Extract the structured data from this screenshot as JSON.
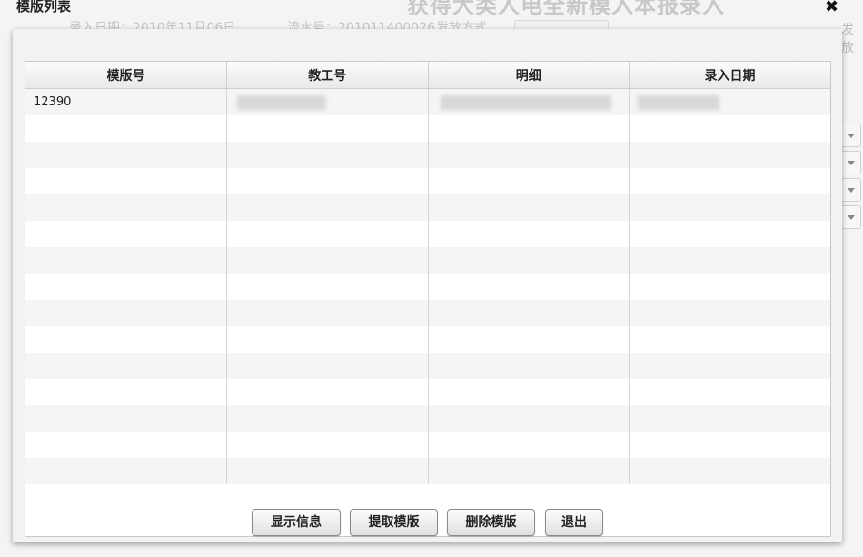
{
  "background": {
    "title": "获得大类人电全新模入本报录入",
    "meta_items": [
      "录入日期：2010年11月06日",
      "流水号：201011400026",
      "发放方式"
    ],
    "right_text": "发放"
  },
  "dialog": {
    "title": "模版列表",
    "close_icon": "close-icon"
  },
  "table": {
    "columns": [
      "模版号",
      "教工号",
      "明细",
      "录入日期"
    ],
    "rows": [
      {
        "template_no": "12390",
        "staff_no": "",
        "detail": "",
        "entry_date": ""
      }
    ],
    "empty_rows": 14
  },
  "buttons": {
    "show_info": "显示信息",
    "extract_template": "提取模版",
    "delete_template": "删除模版",
    "exit": "退出"
  }
}
